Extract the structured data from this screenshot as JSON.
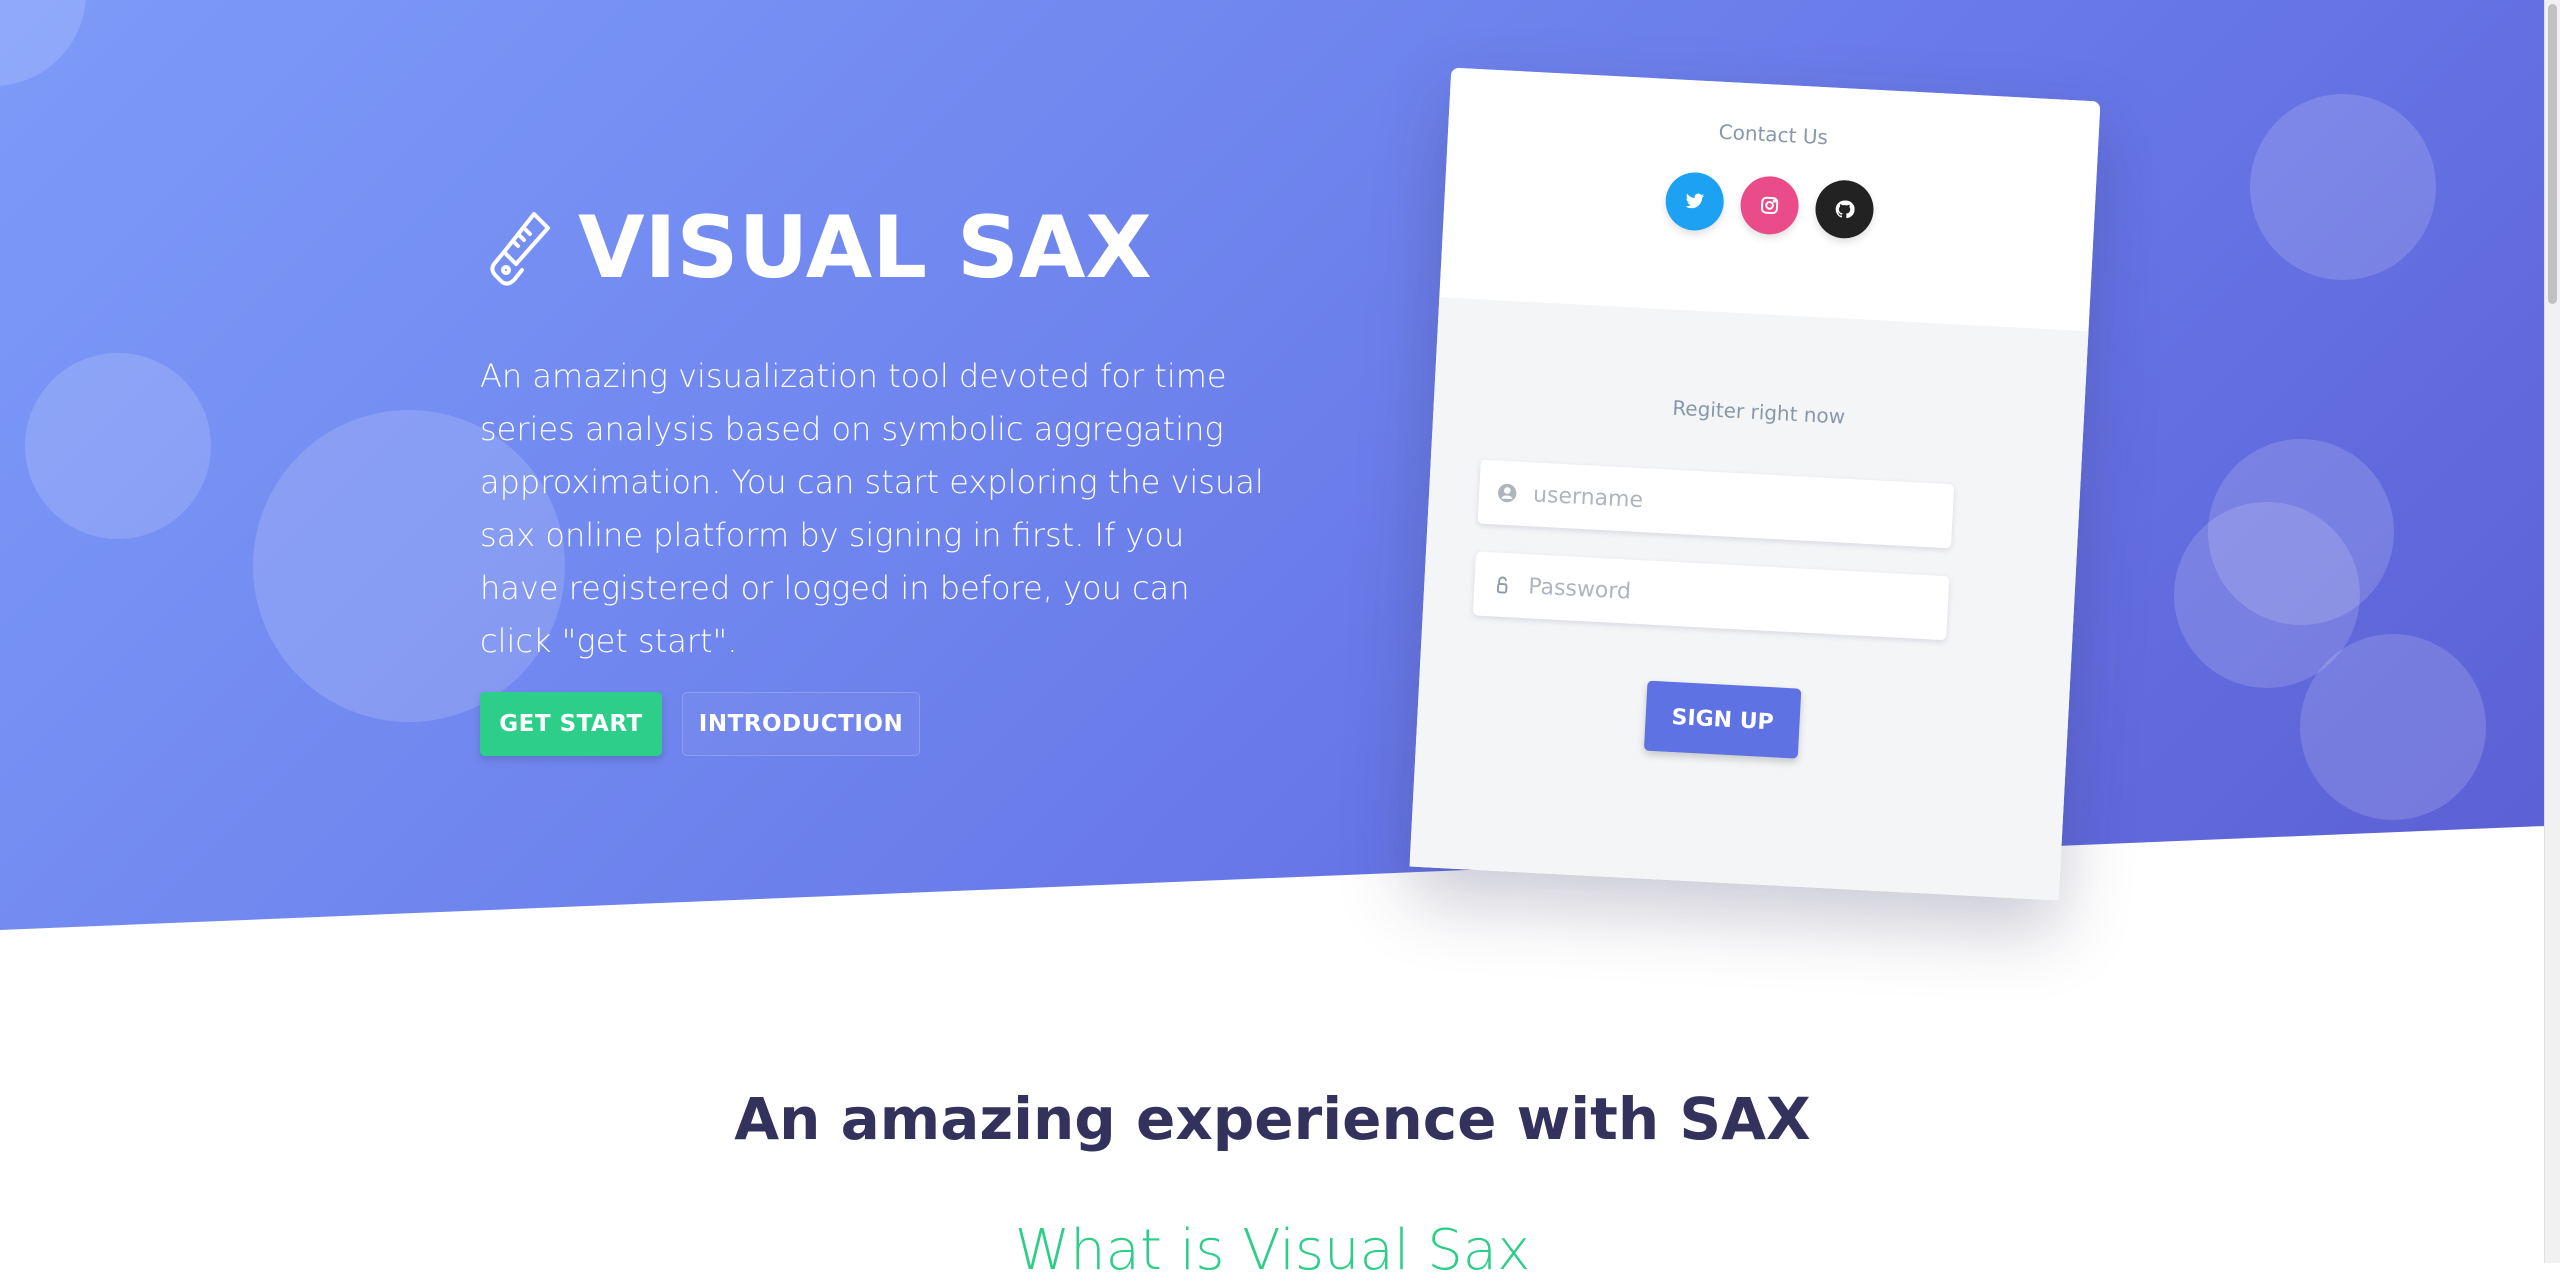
{
  "hero": {
    "brand_icon": "saw-icon",
    "title": "VISUAL SAX",
    "description": "An amazing visualization tool devoted for time series analysis based on symbolic aggregating approximation. You can start exploring the visual sax online platform by signing in first. If you have registered or logged in before, you can click \"get start\".",
    "buttons": {
      "start_label": "GET START",
      "intro_label": "INTRODUCTION"
    },
    "colors": {
      "gradient_start": "#7d9bf9",
      "gradient_end": "#5b5fd2",
      "start_button": "#2dce89"
    }
  },
  "card": {
    "contact_title": "Contact Us",
    "socials": [
      {
        "icon": "twitter-icon",
        "color": "#1da1f2"
      },
      {
        "icon": "instagram-icon",
        "color": "#ea4c89"
      },
      {
        "icon": "github-icon",
        "color": "#222222"
      }
    ],
    "register_title": "Regiter right now",
    "username_placeholder": "username",
    "password_placeholder": "Password",
    "signup_label": "SIGN UP",
    "signup_color": "#5e72e4"
  },
  "section": {
    "title": "An amazing experience with SAX",
    "subtitle": "What is Visual Sax"
  }
}
